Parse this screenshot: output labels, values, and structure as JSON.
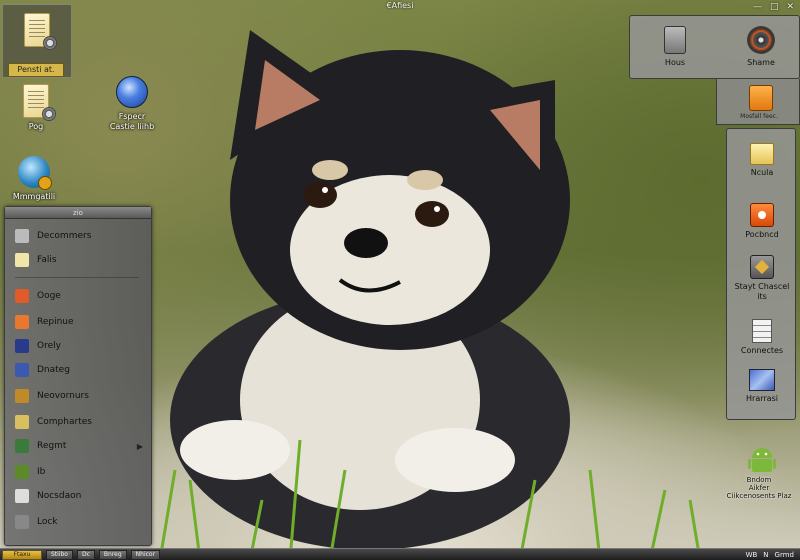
{
  "window": {
    "title": "€Afiesi",
    "controls": [
      "—",
      "□",
      "✕"
    ]
  },
  "desktop_icons": {
    "selected_label": "Pensti at.",
    "pog": "Pog",
    "globe_line1": "Fspecr",
    "globe_line2": "Castie liihb",
    "mm": "Mmmgatili"
  },
  "menu": {
    "header": "zio",
    "items": [
      {
        "label": "Decommers",
        "icon": "power-icon",
        "color": "#bbbbbb"
      },
      {
        "label": "Falis",
        "icon": "folder-icon",
        "color": "#f0e6a8"
      },
      {
        "label": "Ooge",
        "icon": "flower-icon",
        "color": "#e05a2a"
      },
      {
        "label": "Repinue",
        "icon": "image-icon",
        "color": "#e87830"
      },
      {
        "label": "Orely",
        "icon": "check-icon",
        "color": "#2a3a8a"
      },
      {
        "label": "Dnateg",
        "icon": "window-icon",
        "color": "#3a5ab0"
      },
      {
        "label": "Neovornurs",
        "icon": "network-icon",
        "color": "#c08a2a"
      },
      {
        "label": "Comphartes",
        "icon": "envelope-icon",
        "color": "#d8c060"
      },
      {
        "label": "Regmt",
        "icon": "terminal-icon",
        "color": "#3a7a3a",
        "has_arrow": true
      },
      {
        "label": "Ib",
        "icon": "leaf-icon",
        "color": "#5a8a2a"
      },
      {
        "label": "Nocsdaon",
        "icon": "clock-icon",
        "color": "#dddddd"
      },
      {
        "label": "Lock",
        "icon": "lock-icon",
        "color": "#888888"
      }
    ]
  },
  "top_right": {
    "items": [
      {
        "label": "Hous",
        "icon": "drive-icon"
      },
      {
        "label": "Shame",
        "icon": "disc-icon"
      }
    ],
    "orange_sublabel": "Mosfall feec."
  },
  "dock": {
    "items": [
      {
        "label": "Ncula",
        "icon": "folder-icon"
      },
      {
        "label": "Pocbncd",
        "icon": "record-icon"
      },
      {
        "label": "Stayt Chascel its",
        "icon": "share-icon"
      },
      {
        "label": "Connectes",
        "icon": "page-icon"
      },
      {
        "label": "Hrarrasi",
        "icon": "picture-icon"
      }
    ]
  },
  "android": {
    "line1": "Bndom",
    "line2": "Aikfer",
    "line3": "Ciikcenosents Plaz"
  },
  "taskbar": {
    "start": "Ftaxu",
    "buttons": [
      "Stiibo",
      "Dc",
      "Bnreg",
      "Nhicor"
    ],
    "tray": [
      "WB",
      "N",
      "Grmd"
    ]
  }
}
